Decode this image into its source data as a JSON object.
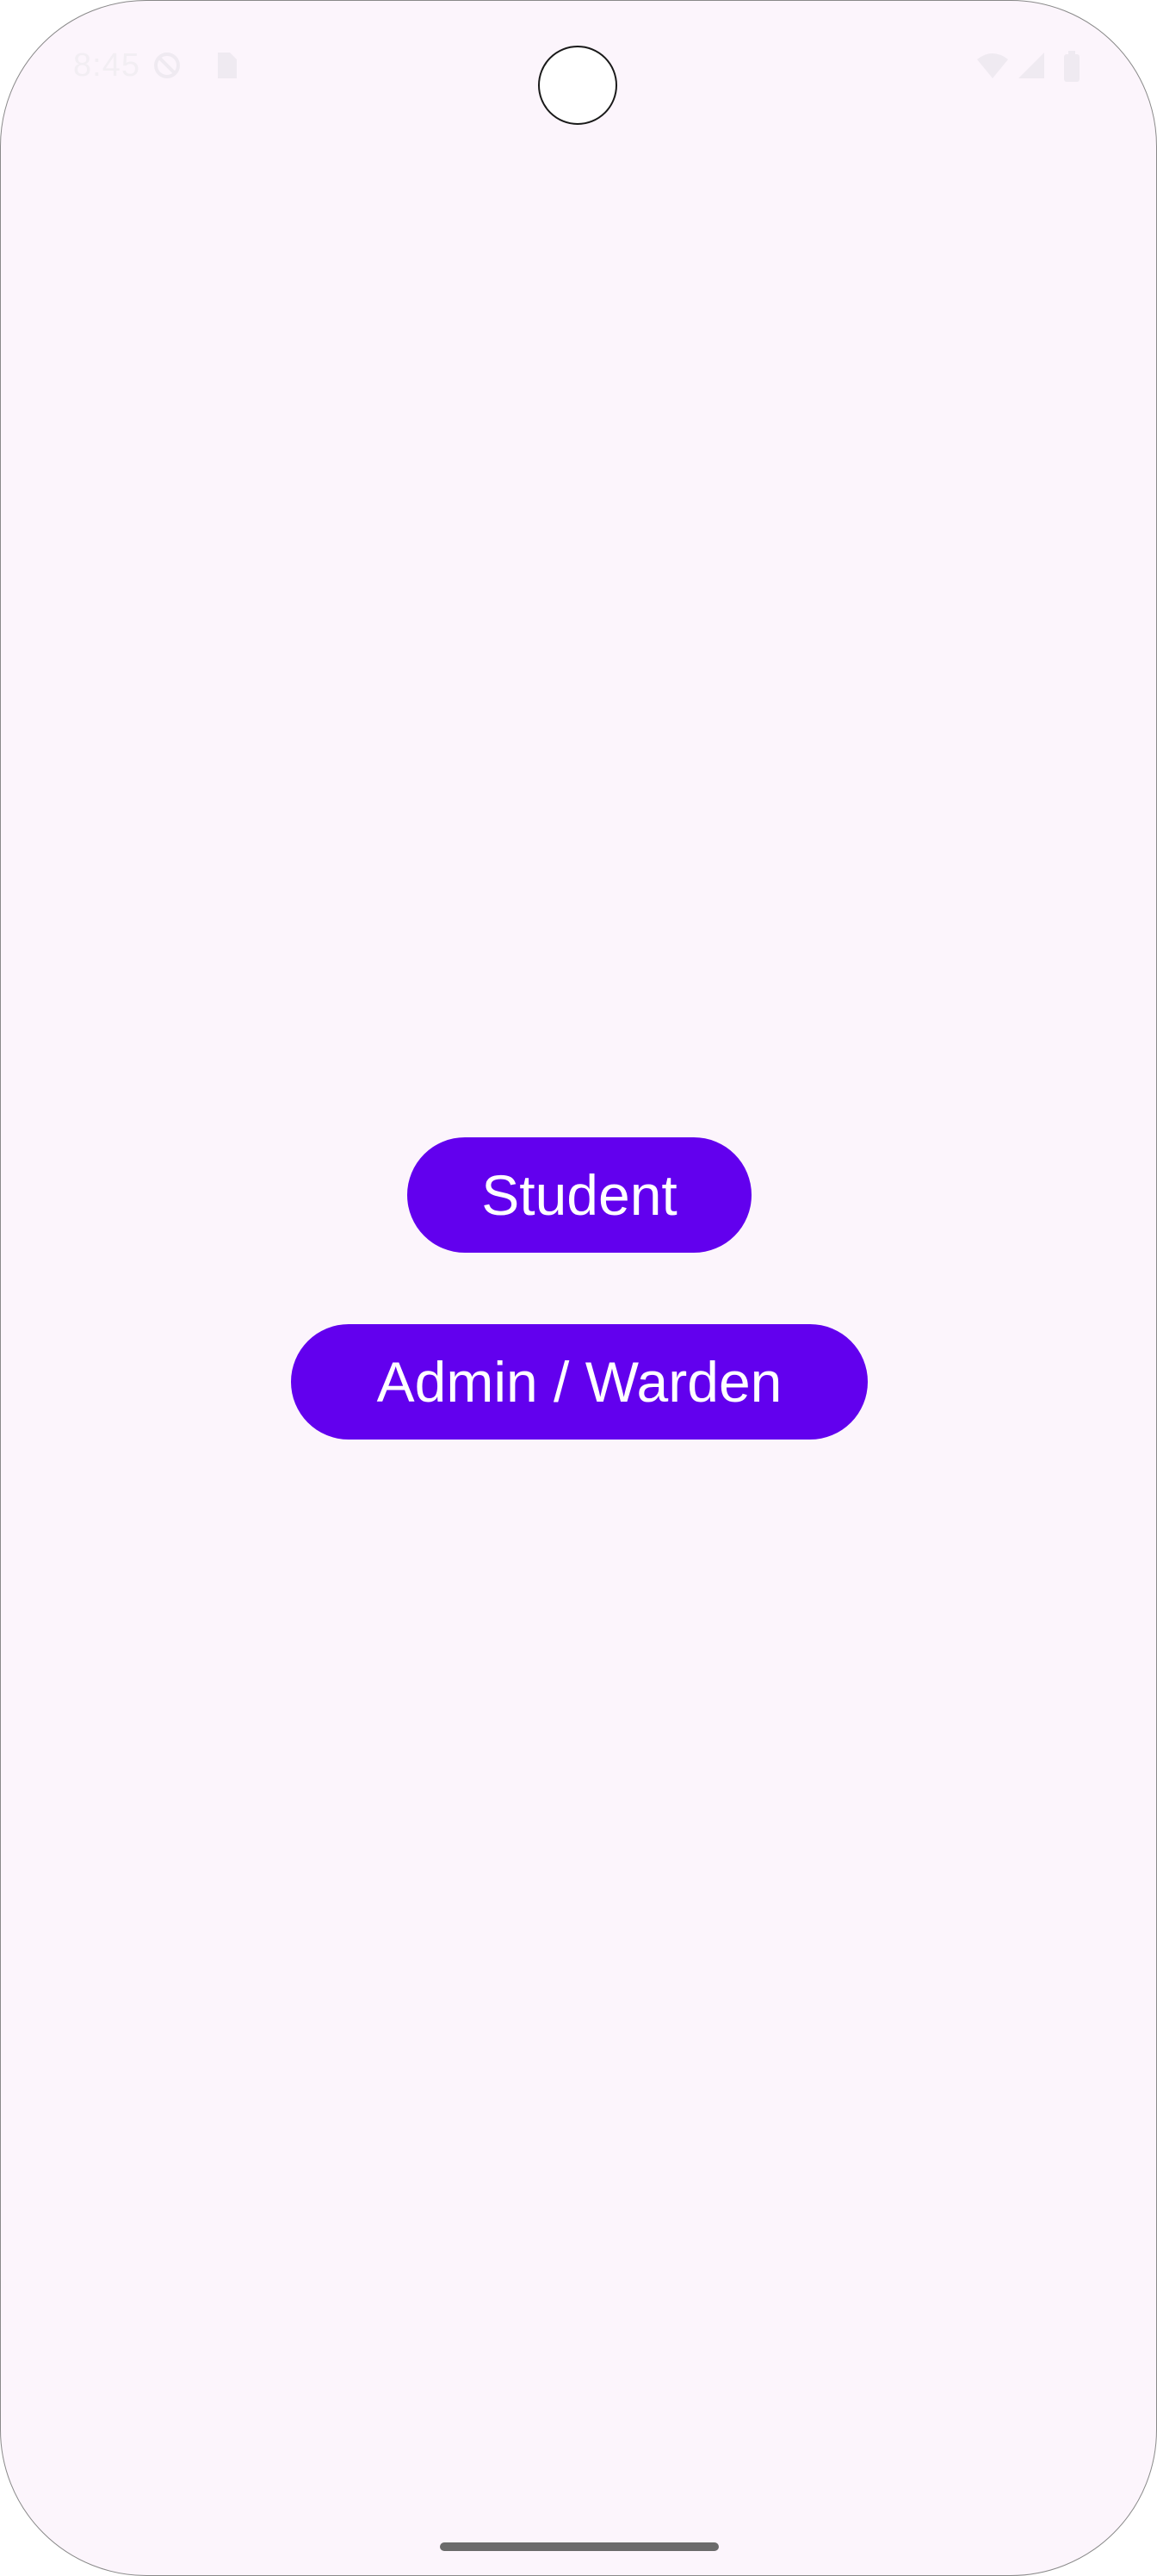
{
  "status_bar": {
    "time": "8:45",
    "icons": [
      "no-disturb-icon",
      "sim-card-icon",
      "wifi-icon",
      "signal-icon",
      "battery-icon"
    ]
  },
  "main": {
    "buttons": [
      {
        "label": "Student"
      },
      {
        "label": "Admin / Warden"
      }
    ]
  },
  "colors": {
    "background": "#FCF5FC",
    "button": "#6200EE",
    "button_text": "#FFFFFF"
  }
}
